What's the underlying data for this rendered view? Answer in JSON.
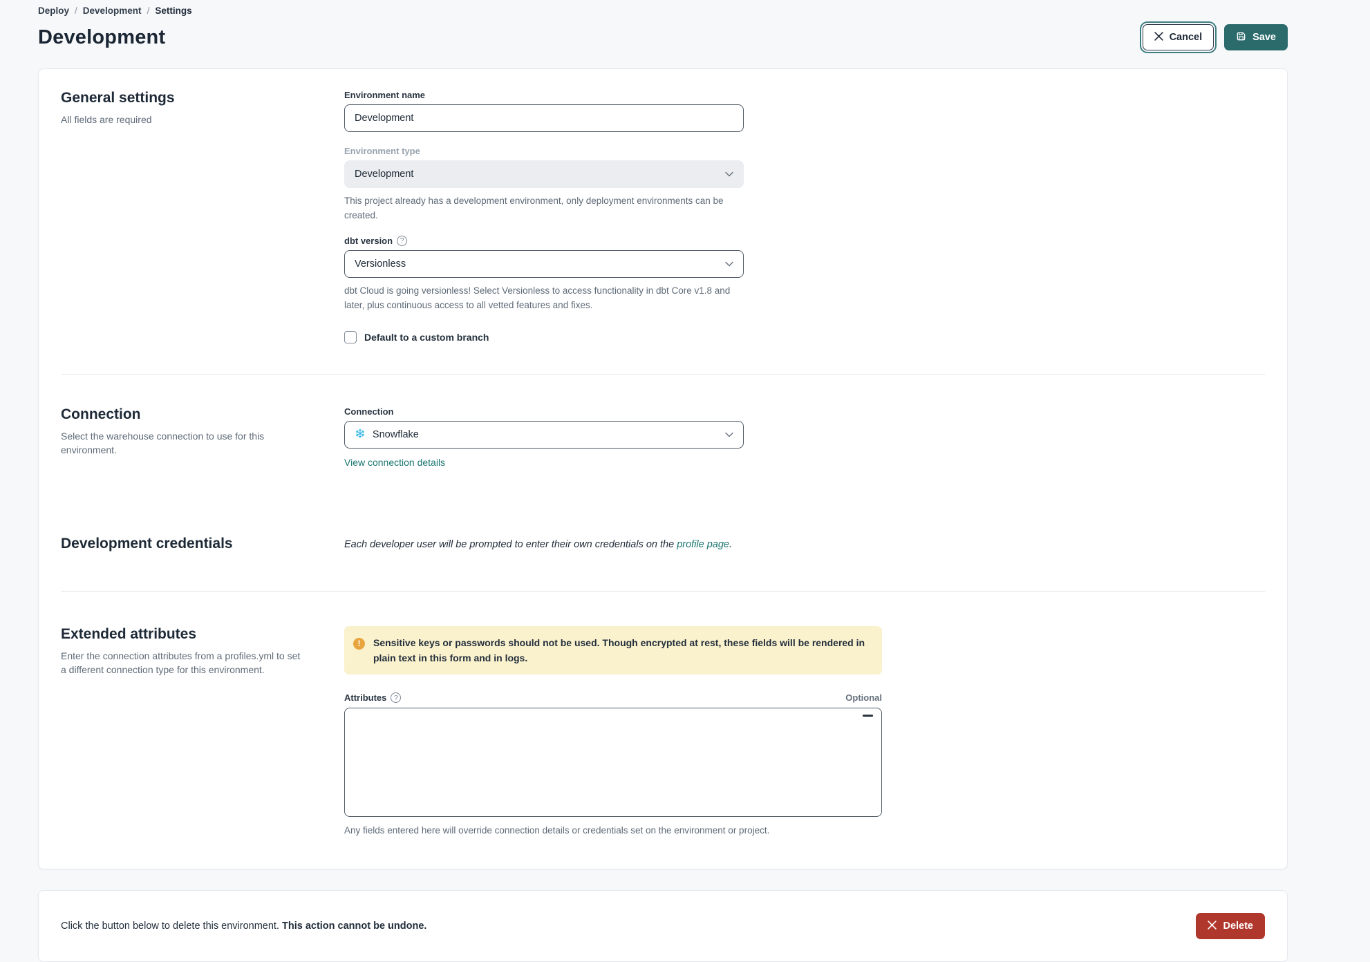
{
  "breadcrumb": {
    "items": [
      "Deploy",
      "Development",
      "Settings"
    ],
    "separator": "/"
  },
  "header": {
    "title": "Development",
    "cancel_label": "Cancel",
    "save_label": "Save"
  },
  "general": {
    "heading": "General settings",
    "subheading": "All fields are required",
    "env_name": {
      "label": "Environment name",
      "value": "Development"
    },
    "env_type": {
      "label": "Environment type",
      "value": "Development",
      "help": "This project already has a development environment, only deployment environments can be created."
    },
    "dbt_version": {
      "label": "dbt version",
      "value": "Versionless",
      "help": "dbt Cloud is going versionless! Select Versionless to access functionality in dbt Core v1.8 and later, plus continuous access to all vetted features and fixes."
    },
    "custom_branch": {
      "label": "Default to a custom branch",
      "checked": false
    }
  },
  "connection": {
    "heading": "Connection",
    "subheading": "Select the warehouse connection to use for this environment.",
    "field_label": "Connection",
    "value": "Snowflake",
    "link": "View connection details"
  },
  "credentials": {
    "heading": "Development credentials",
    "note_prefix": "Each developer user will be prompted to enter their own credentials on the ",
    "note_link": "profile page",
    "note_suffix": "."
  },
  "extended": {
    "heading": "Extended attributes",
    "subheading": "Enter the connection attributes from a profiles.yml to set a different connection type for this environment.",
    "warning": "Sensitive keys or passwords should not be used. Though encrypted at rest, these fields will be rendered in plain text in this form and in logs.",
    "attributes_label": "Attributes",
    "optional_label": "Optional",
    "help": "Any fields entered here will override connection details or credentials set on the environment or project."
  },
  "danger": {
    "text_normal": "Click the button below to delete this environment. ",
    "text_bold": "This action cannot be undone.",
    "delete_label": "Delete"
  },
  "icons": {
    "snowflake": "❄",
    "help": "?",
    "warning": "!"
  },
  "colors": {
    "accent_teal": "#2c6b6c",
    "danger_red": "#b0372c",
    "link_teal": "#19756f",
    "warning_bg": "#faf1cd",
    "warning_icon": "#e8a53d",
    "snowflake_blue": "#2fb6e8",
    "page_bg": "#f7f8fa"
  }
}
